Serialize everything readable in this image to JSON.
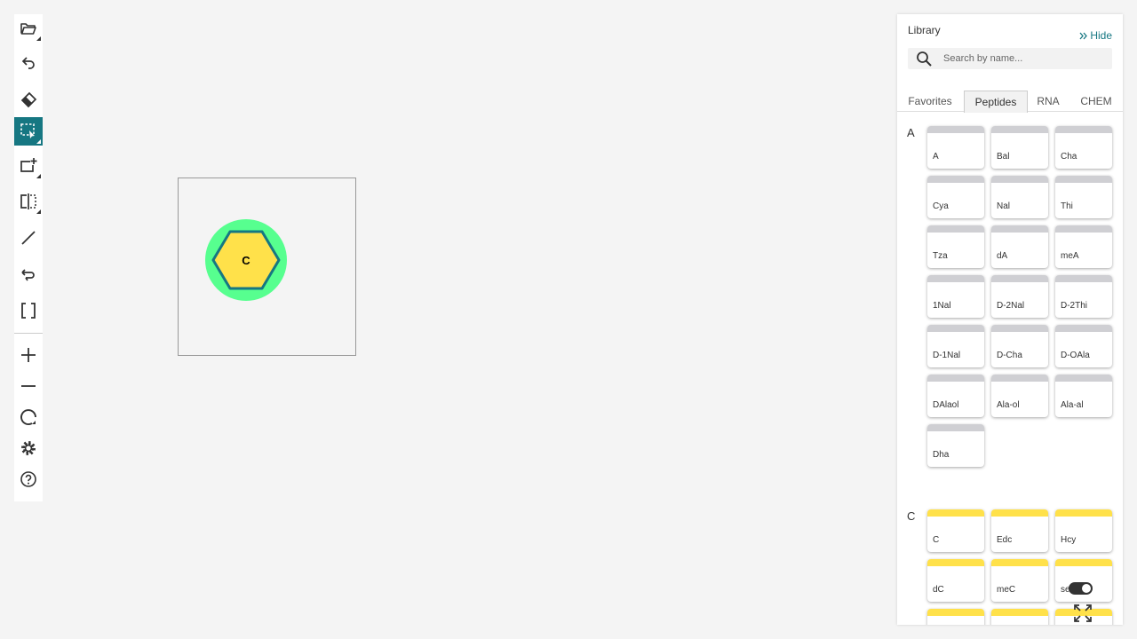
{
  "toolbar": {
    "tools": [
      {
        "name": "open-file",
        "icon": "folder-icon",
        "active": false,
        "has_submenu": true
      },
      {
        "name": "undo",
        "icon": "undo-icon",
        "active": false,
        "has_submenu": false
      },
      {
        "name": "erase",
        "icon": "eraser-icon",
        "active": false,
        "has_submenu": false
      },
      {
        "name": "select",
        "icon": "select-rectangle-icon",
        "active": true,
        "has_submenu": true
      },
      {
        "name": "create-antisense",
        "icon": "add-rectangle-icon",
        "active": false,
        "has_submenu": true
      },
      {
        "name": "flip",
        "icon": "mirror-icon",
        "active": false,
        "has_submenu": true
      },
      {
        "name": "single-bond",
        "icon": "bond-line-icon",
        "active": false,
        "has_submenu": false
      },
      {
        "name": "hydrogen-bond",
        "icon": "curved-bond-icon",
        "active": false,
        "has_submenu": false
      },
      {
        "name": "brackets",
        "icon": "brackets-icon",
        "active": false,
        "has_submenu": false
      },
      {
        "name": "zoom-in",
        "icon": "plus-icon",
        "active": false,
        "has_submenu": false
      },
      {
        "name": "zoom-out",
        "icon": "minus-icon",
        "active": false,
        "has_submenu": false
      },
      {
        "name": "reset-zoom",
        "icon": "reset-icon",
        "active": false,
        "has_submenu": false
      },
      {
        "name": "settings",
        "icon": "gear-icon",
        "active": false,
        "has_submenu": false
      },
      {
        "name": "help",
        "icon": "help-icon",
        "active": false,
        "has_submenu": false
      }
    ],
    "accent": "#167782"
  },
  "canvas": {
    "monomer": {
      "label": "C",
      "outer_color": "#57ff8f",
      "hex_fill": "#ffe14a",
      "hex_stroke": "#167782"
    }
  },
  "library": {
    "title": "Library",
    "hide_label": "Hide",
    "search": {
      "placeholder": "Search by name...",
      "value": ""
    },
    "tabs": [
      "Favorites",
      "Peptides",
      "RNA",
      "CHEM"
    ],
    "active_tab": "Peptides",
    "sections": [
      {
        "letter": "A",
        "bar_color": "#cfcfd3",
        "items": [
          "A",
          "Bal",
          "Cha",
          "Cya",
          "Nal",
          "Thi",
          "Tza",
          "dA",
          "meA",
          "1Nal",
          "D-2Nal",
          "D-2Thi",
          "D-1Nal",
          "D-Cha",
          "D-OAla",
          "DAlaol",
          "Ala-ol",
          "Ala-al",
          "Dha"
        ]
      },
      {
        "letter": "C",
        "bar_color": "#ffe14a",
        "items": [
          "C",
          "Edc",
          "Hcy",
          "dC",
          "meC",
          "se",
          "",
          "",
          ""
        ]
      }
    ],
    "toggle_on": true
  }
}
